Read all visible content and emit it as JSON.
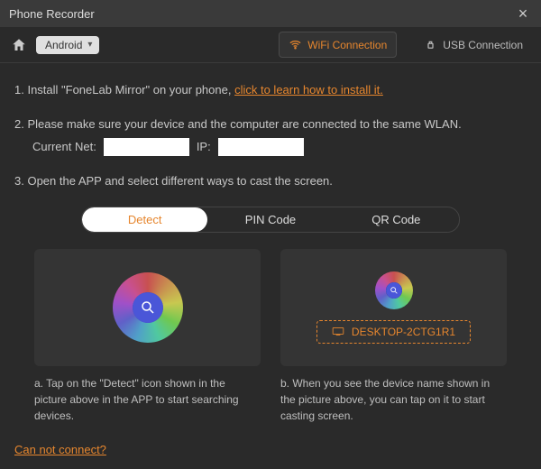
{
  "window": {
    "title": "Phone Recorder"
  },
  "topbar": {
    "platform": "Android",
    "tabs": {
      "wifi": "WiFi Connection",
      "usb": "USB Connection"
    }
  },
  "steps": {
    "s1_prefix": "1. Install \"FoneLab Mirror\" on your phone, ",
    "s1_link": "click to learn how to install it.",
    "s2": "2. Please make sure your device and the computer are connected to the same WLAN.",
    "current_net_label": "Current Net:",
    "current_net_value": "",
    "ip_label": "IP:",
    "ip_value": "",
    "s3": "3. Open the APP and select different ways to cast the screen."
  },
  "modes": {
    "detect": "Detect",
    "pin": "PIN Code",
    "qr": "QR Code"
  },
  "device": {
    "name": "DESKTOP-2CTG1R1"
  },
  "captions": {
    "a": "a. Tap on the \"Detect\" icon shown in the picture above in the APP to start searching devices.",
    "b": "b. When you see the device name shown in the picture above, you can tap on it to start casting screen."
  },
  "footer": {
    "cannot_connect": "Can not connect?"
  }
}
